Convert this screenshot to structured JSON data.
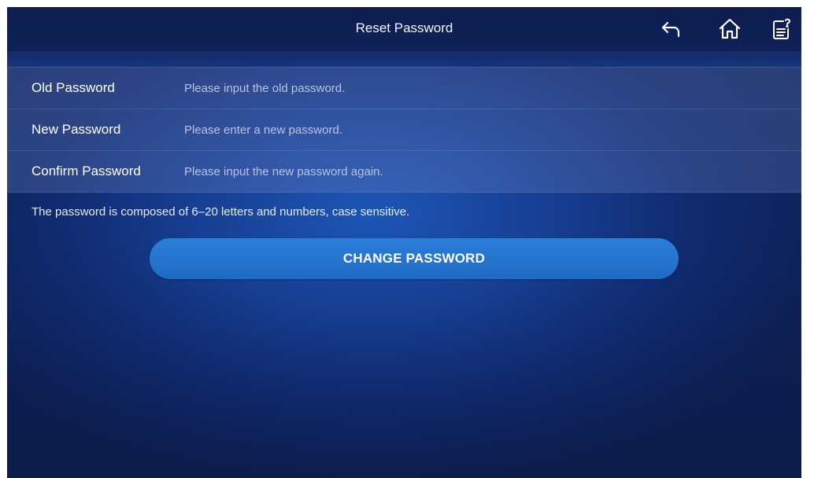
{
  "header": {
    "title": "Reset Password",
    "icons": [
      "back-icon",
      "home-icon",
      "help-document-icon"
    ]
  },
  "form": {
    "fields": [
      {
        "label": "Old Password",
        "placeholder": "Please input the old password.",
        "value": ""
      },
      {
        "label": "New Password",
        "placeholder": "Please enter a new password.",
        "value": ""
      },
      {
        "label": "Confirm Password",
        "placeholder": "Please input the new password again.",
        "value": ""
      }
    ],
    "hint": "The password is composed of 6–20 letters and numbers, case sensitive.",
    "submit_label": "CHANGE PASSWORD"
  },
  "colors": {
    "background": "#0f2358",
    "accent": "#2c7fd9",
    "row_fill": "#4a5ea0",
    "text": "#ffffff",
    "placeholder": "#b9c3e0"
  }
}
